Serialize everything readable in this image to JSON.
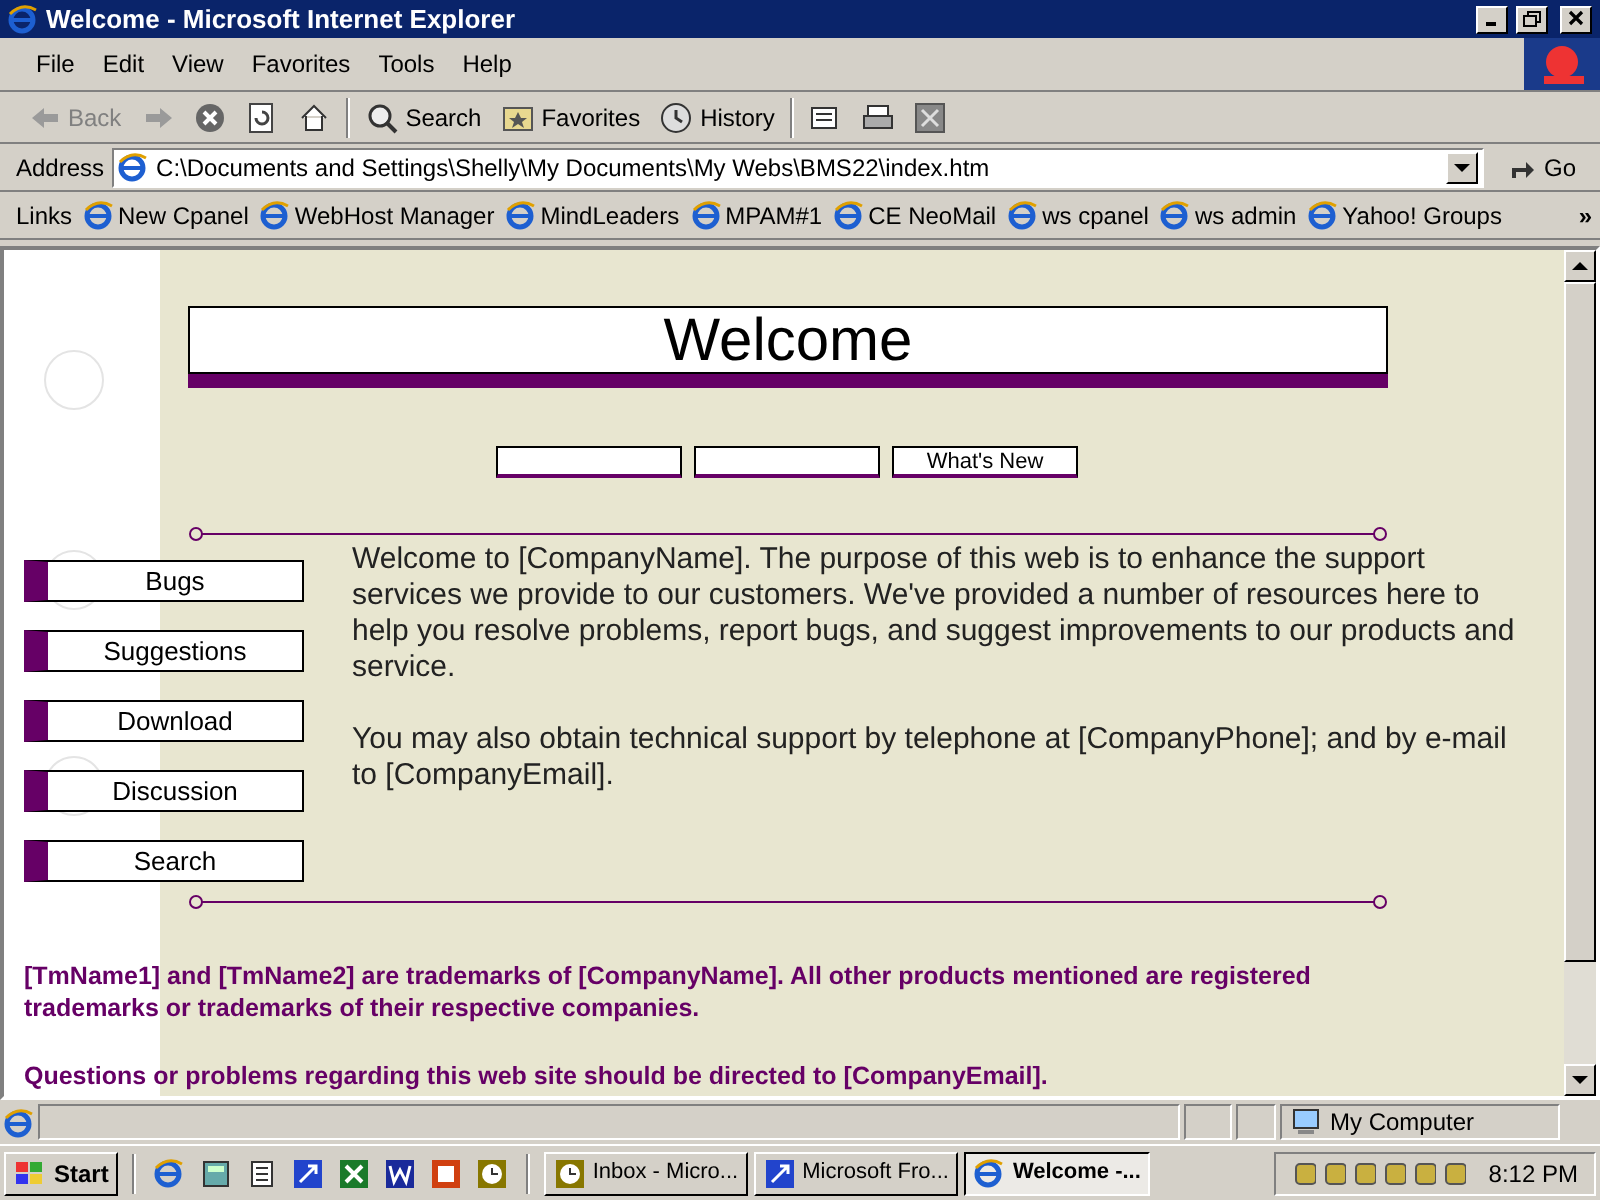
{
  "window": {
    "title": "Welcome - Microsoft Internet Explorer"
  },
  "menu_bar": [
    "File",
    "Edit",
    "View",
    "Favorites",
    "Tools",
    "Help"
  ],
  "toolbar": [
    {
      "kind": "back",
      "label": "Back",
      "disabled": true
    },
    {
      "kind": "forward",
      "disabled": true
    },
    {
      "kind": "stop"
    },
    {
      "kind": "refresh"
    },
    {
      "kind": "home"
    },
    {
      "kind": "search",
      "label": "Search"
    },
    {
      "kind": "favorites",
      "label": "Favorites"
    },
    {
      "kind": "history",
      "label": "History"
    },
    {
      "kind": "mail"
    },
    {
      "kind": "print"
    },
    {
      "kind": "edit"
    }
  ],
  "address_bar": {
    "label": "Address",
    "value": "C:\\Documents and Settings\\Shelly\\My Documents\\My Webs\\BMS22\\index.htm",
    "go": "Go"
  },
  "links_bar": {
    "label": "Links",
    "items": [
      "New Cpanel",
      "WebHost Manager",
      "MindLeaders",
      "MPAM#1",
      "CE NeoMail",
      "ws cpanel",
      "ws admin",
      "Yahoo! Groups"
    ],
    "more": "»"
  },
  "page": {
    "banner_title": "Welcome",
    "top_buttons": [
      {
        "kind": "blank"
      },
      {
        "kind": "blank"
      },
      {
        "kind": "labeled",
        "label": "What's New"
      }
    ],
    "side_nav": [
      "Bugs",
      "Suggestions",
      "Download",
      "Discussion",
      "Search"
    ],
    "body": [
      "Welcome to [CompanyName]. The purpose of this web is to enhance the support services we provide to our customers. We've provided a number of resources here to help you resolve problems, report bugs, and suggest improvements to our products and service.",
      "You may also obtain technical support by telephone at [CompanyPhone]; and by e-mail to [CompanyEmail]."
    ],
    "footer": [
      "[TmName1] and [TmName2] are trademarks of [CompanyName]. All other products mentioned are registered trademarks or trademarks of their respective companies.",
      "Questions or problems regarding this web site should be directed to [CompanyEmail]."
    ]
  },
  "status_bar": {
    "zone": "My Computer"
  },
  "taskbar": {
    "start": "Start",
    "tasks": [
      {
        "label": "Inbox - Micro...",
        "selected": false
      },
      {
        "label": "Microsoft Fro...",
        "selected": false
      },
      {
        "label": "Welcome -...",
        "selected": true
      }
    ],
    "clock": "8:12 PM"
  }
}
